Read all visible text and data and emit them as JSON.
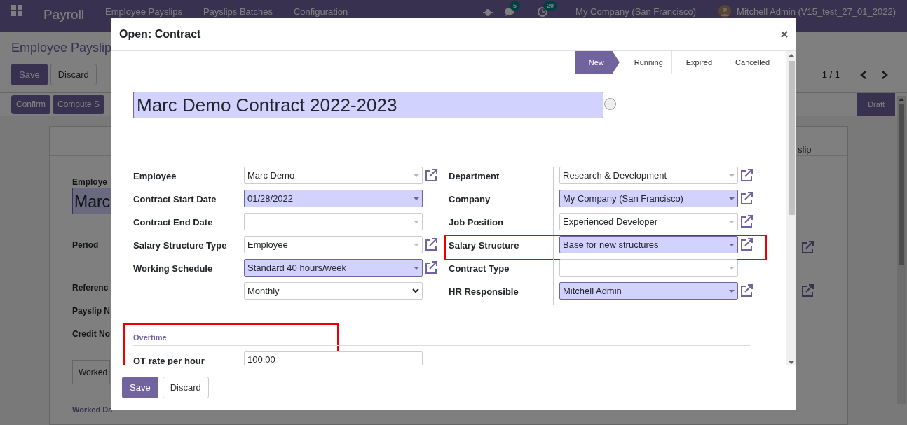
{
  "background": {
    "app_name": "Payroll",
    "menu": [
      "Employee Payslips",
      "Payslips Batches",
      "Configuration"
    ],
    "messages_count": "5",
    "activities_count": "20",
    "company": "My Company (San Francisco)",
    "user": "Mitchell Admin (V15_test_27_01_2022)",
    "breadcrumb": "Employee Payslip",
    "buttons": [
      "Save",
      "Discard"
    ],
    "pager": "1 / 1",
    "actions": [
      "Confirm",
      "Compute S"
    ],
    "status": [
      {
        "label": "Draft",
        "selected": true
      }
    ],
    "tab_fragment": "slip",
    "label_fragment": "Employe",
    "name_fragment": "Marc",
    "labels": [
      "Period",
      "Referenc",
      "Payslip N",
      "Credit No"
    ],
    "tabs": [
      "Worked"
    ],
    "section": "Worked Da"
  },
  "dialog": {
    "title": "Open: Contract",
    "statusbar": [
      {
        "label": "New",
        "selected": true
      },
      {
        "label": "Running",
        "selected": false
      },
      {
        "label": "Expired",
        "selected": false
      },
      {
        "label": "Cancelled",
        "selected": false
      }
    ],
    "name": "Marc Demo Contract 2022-2023",
    "left_fields": [
      {
        "kind": "many2one",
        "label": "Employee",
        "value": "Marc Demo",
        "required": false,
        "link": true,
        "highlighted": false
      },
      {
        "kind": "many2one",
        "label": "Contract Start Date",
        "value": "01/28/2022",
        "required": true,
        "link": false,
        "highlighted": false
      },
      {
        "kind": "many2one",
        "label": "Contract End Date",
        "required": false,
        "link": false,
        "highlighted": false
      },
      {
        "kind": "many2one",
        "label": "Salary Structure Type",
        "value": "Employee",
        "required": false,
        "link": true,
        "highlighted": false
      },
      {
        "kind": "many2one",
        "label": "Working Schedule",
        "value": "Standard 40 hours/week",
        "required": true,
        "link": true,
        "highlighted": false
      },
      {
        "kind": "select",
        "value": "Monthly",
        "required": false,
        "link": false,
        "highlighted": false
      }
    ],
    "right_fields": [
      {
        "kind": "many2one",
        "label": "Department",
        "value": "Research & Development",
        "required": false,
        "link": true,
        "highlighted": false
      },
      {
        "kind": "many2one",
        "label": "Company",
        "value": "My Company (San Francisco)",
        "required": true,
        "link": true,
        "highlighted": false
      },
      {
        "kind": "many2one",
        "label": "Job Position",
        "value": "Experienced Developer",
        "required": false,
        "link": true,
        "highlighted": false
      },
      {
        "kind": "many2one",
        "label": "Salary Structure",
        "value": "Base for new structures",
        "required": true,
        "link": true,
        "highlighted": true
      },
      {
        "kind": "many2one",
        "label": "Contract Type",
        "required": false,
        "link": false,
        "highlighted": false
      },
      {
        "kind": "many2one",
        "label": "HR Responsible",
        "value": "Mitchell Admin",
        "required": true,
        "link": true,
        "highlighted": false
      }
    ],
    "overtime": {
      "title": "Overtime",
      "highlighted": true,
      "fields": [
        {
          "label": "OT rate per hour",
          "value": "100.00"
        }
      ]
    },
    "buttons": [
      "Save",
      "Discard"
    ]
  }
}
